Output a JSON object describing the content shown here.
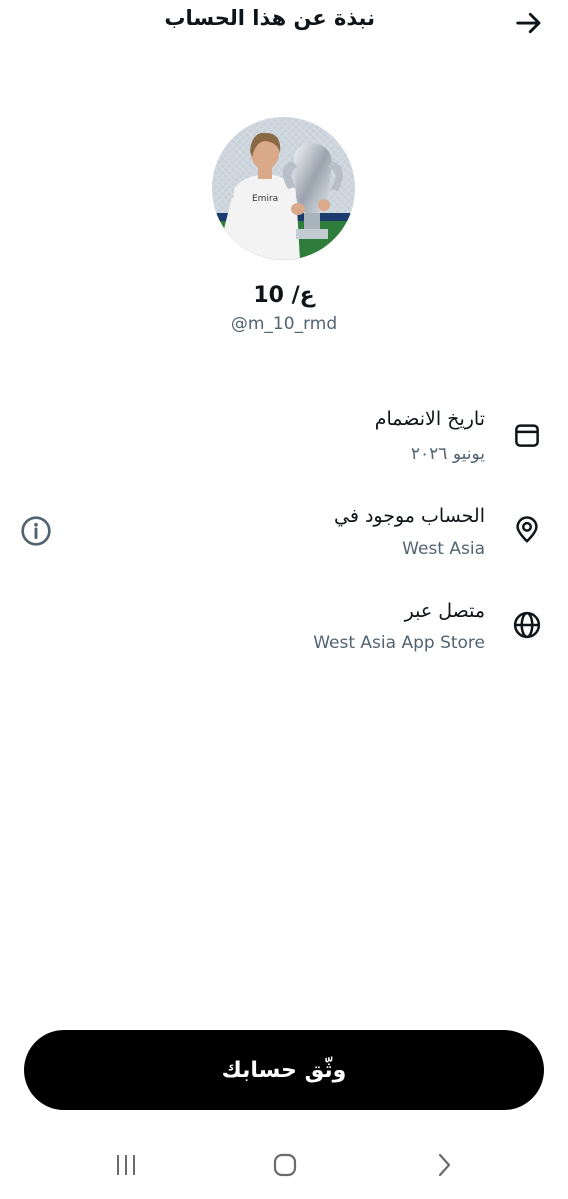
{
  "header": {
    "title": "نبذة عن هذا الحساب",
    "back_icon": "arrow-right-icon"
  },
  "profile": {
    "display_name": "ع/ 10",
    "handle": "@m_10_rmd",
    "avatar_icon": "profile-photo"
  },
  "details": [
    {
      "icon": "calendar-icon",
      "label": "تاريخ الانضمام",
      "value": "يونيو ٢٠٢٦"
    },
    {
      "icon": "location-pin-icon",
      "label": "الحساب موجود في",
      "value": "West Asia"
    },
    {
      "icon": "globe-icon",
      "label": "متصل عبر",
      "value": "West Asia App Store"
    }
  ],
  "info_icon": "info-icon",
  "verify_button": {
    "label": "وثّق حسابك"
  },
  "navbar": {
    "recents_icon": "recents-icon",
    "home_icon": "home-icon",
    "back_icon": "nav-back-icon"
  },
  "colors": {
    "text_primary": "#0f1419",
    "text_secondary": "#536471",
    "button_bg": "#000000",
    "button_text": "#ffffff"
  }
}
